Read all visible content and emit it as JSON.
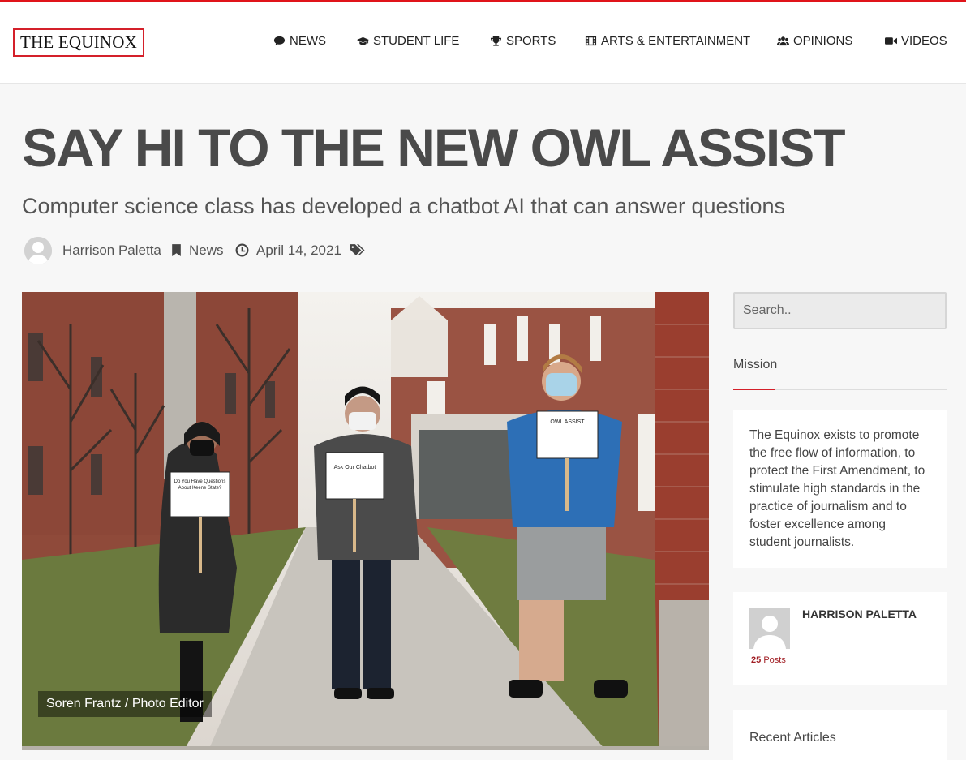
{
  "site": {
    "logo_text": "THE EQUINOX",
    "accent_color": "#d4202a"
  },
  "nav": {
    "items": [
      {
        "label": "NEWS",
        "icon": "comment-icon"
      },
      {
        "label": "STUDENT LIFE",
        "icon": "graduation-cap-icon"
      },
      {
        "label": "SPORTS",
        "icon": "trophy-icon"
      },
      {
        "label": "ARTS & ENTERTAINMENT",
        "icon": "film-icon"
      },
      {
        "label": "OPINIONS",
        "icon": "users-icon"
      },
      {
        "label": "VIDEOS",
        "icon": "video-camera-icon"
      }
    ]
  },
  "article": {
    "title": "SAY HI TO THE NEW OWL ASSIST",
    "subtitle": "Computer science class has developed a chatbot AI that can answer questions",
    "author": "Harrison Paletta",
    "category": "News",
    "date": "April 14, 2021",
    "photo_credit": "Soren Frantz / Photo Editor",
    "photo_signs": {
      "left": "Do You Have Questions About Keene State?",
      "middle": "Ask Our Chatbot",
      "right": "OWL ASSIST"
    }
  },
  "sidebar": {
    "search": {
      "placeholder": "Search.."
    },
    "mission": {
      "tab_label": "Mission",
      "text": "The Equinox exists to promote the free flow of information, to protect the First Amendment, to stimulate high standards in the practice of journalism and to foster excellence among student journalists."
    },
    "author_box": {
      "name": "HARRISON PALETTA",
      "post_count": "25",
      "posts_label": "Posts"
    },
    "recent": {
      "title": "Recent Articles"
    }
  }
}
